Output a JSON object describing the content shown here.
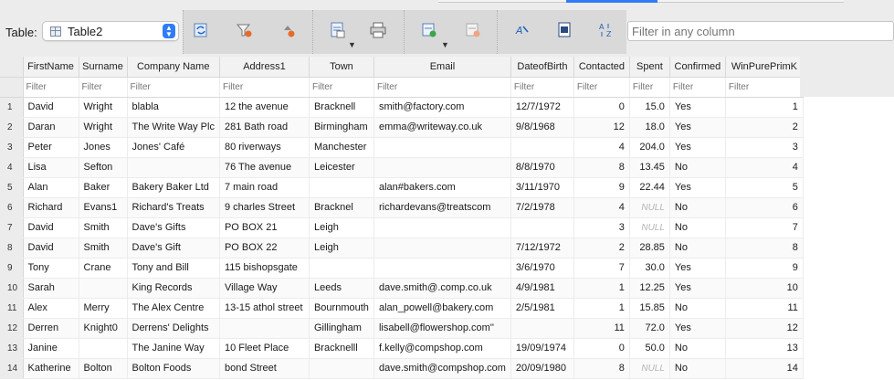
{
  "toolbar": {
    "table_label": "Table:",
    "table_select": "Table2",
    "filter_placeholder": "Filter in any column"
  },
  "icons": {
    "refresh": "refresh-icon",
    "clear_filter": "clear-filter-icon",
    "clear_sort": "clear-sort-icon",
    "export": "export-icon",
    "print": "print-icon",
    "add_record": "add-record-icon",
    "delete_record": "delete-record-icon",
    "find_replace": "find-replace-icon",
    "document": "document-icon",
    "sort": "sort-icon"
  },
  "grid": {
    "columns": [
      "FirstName",
      "Surname",
      "Company Name",
      "Address1",
      "Town",
      "Email",
      "DateofBirth",
      "Contacted",
      "Spent",
      "Confirmed",
      "WinPurePrimK"
    ],
    "filter_placeholder": "Filter",
    "null_text": "NULL",
    "rows": [
      [
        "1",
        "David",
        "Wright",
        "blabla",
        "12 the avenue",
        "Bracknell",
        "smith@factory.com",
        "12/7/1972",
        "0",
        "15.0",
        "Yes",
        "1"
      ],
      [
        "2",
        "Daran",
        "Wright",
        "The Write Way Plc",
        "281 Bath road",
        "Birmingham",
        "emma@writeway.co.uk",
        "9/8/1968",
        "12",
        "18.0",
        "Yes",
        "2"
      ],
      [
        "3",
        "Peter",
        "Jones",
        "Jones' Café",
        "80 riverways",
        "Manchester",
        "",
        "",
        "4",
        "204.0",
        "Yes",
        "3"
      ],
      [
        "4",
        "Lisa",
        "Sefton",
        "",
        "76 The avenue",
        "Leicester",
        "",
        "8/8/1970",
        "8",
        "13.45",
        "No",
        "4"
      ],
      [
        "5",
        "Alan",
        "Baker",
        "Bakery Baker Ltd",
        "7 main road",
        "",
        "alan#bakers.com",
        "3/11/1970",
        "9",
        "22.44",
        "Yes",
        "5"
      ],
      [
        "6",
        "Richard",
        "Evans1",
        "Richard's Treats",
        "9 charles Street",
        "Bracknel",
        "richardevans@treatscom",
        "7/2/1978",
        "4",
        "NULL",
        "No",
        "6"
      ],
      [
        "7",
        "David",
        "Smith",
        "Dave's Gifts",
        "PO BOX 21",
        "Leigh",
        "",
        "",
        "3",
        "NULL",
        "No",
        "7"
      ],
      [
        "8",
        "David",
        "Smith",
        "Dave's Gift",
        "PO BOX 22",
        "Leigh",
        "",
        "7/12/1972",
        "2",
        "28.85",
        "No",
        "8"
      ],
      [
        "9",
        "Tony",
        "Crane",
        "Tony and Bill",
        "115 bishopsgate",
        "",
        "",
        "3/6/1970",
        "7",
        "30.0",
        "Yes",
        "9"
      ],
      [
        "10",
        "Sarah",
        "",
        "King Records",
        "Village Way",
        "Leeds",
        "dave.smith@.comp.co.uk",
        "4/9/1981",
        "1",
        "12.25",
        "Yes",
        "10"
      ],
      [
        "11",
        "Alex",
        "Merry",
        "The Alex Centre",
        "13-15 athol street",
        "Bournmouth",
        "alan_powell@bakery.com",
        "2/5/1981",
        "1",
        "15.85",
        "No",
        "11"
      ],
      [
        "12",
        "Derren",
        "Knight0",
        "Derrens' Delights",
        "",
        "Gillingham",
        "lisabell@flowershop.com''",
        "",
        "11",
        "72.0",
        "Yes",
        "12"
      ],
      [
        "13",
        "Janine",
        "",
        "The Janine Way",
        "10 Fleet Place",
        "Bracknelll",
        "f.kelly@compshop.com",
        "19/09/1974",
        "0",
        "50.0",
        "No",
        "13"
      ],
      [
        "14",
        "Katherine",
        "Bolton",
        "Bolton Foods",
        "bond Street",
        "",
        "dave.smith@compshop.com",
        "20/09/1980",
        "8",
        "NULL",
        "No",
        "14"
      ]
    ]
  }
}
